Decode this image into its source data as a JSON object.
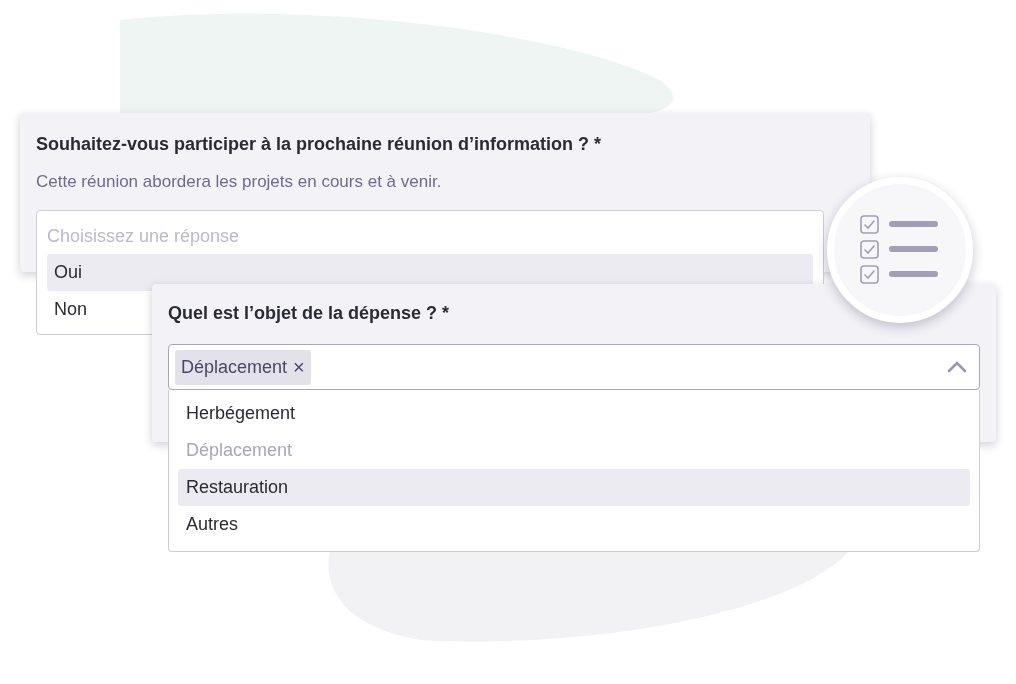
{
  "question_1": {
    "title": "Souhaitez-vous participer à la prochaine réunion d’information ? *",
    "description": "Cette réunion abordera les projets en cours et à venir.",
    "select": {
      "placeholder": "Choisissez une réponse",
      "expanded": true,
      "options": [
        {
          "label": "Oui",
          "highlighted": true
        },
        {
          "label": "Non",
          "highlighted": false
        }
      ]
    }
  },
  "question_2": {
    "title": "Quel est l’objet de la dépense ? *",
    "select": {
      "tags": [
        {
          "label": "Déplacement",
          "remove": "×"
        }
      ],
      "expanded": true,
      "options": [
        {
          "label": "Herbégement",
          "disabled": false,
          "highlighted": false
        },
        {
          "label": "Déplacement",
          "disabled": true,
          "highlighted": false
        },
        {
          "label": "Restauration",
          "disabled": false,
          "highlighted": true
        },
        {
          "label": "Autres",
          "disabled": false,
          "highlighted": false
        }
      ]
    }
  }
}
